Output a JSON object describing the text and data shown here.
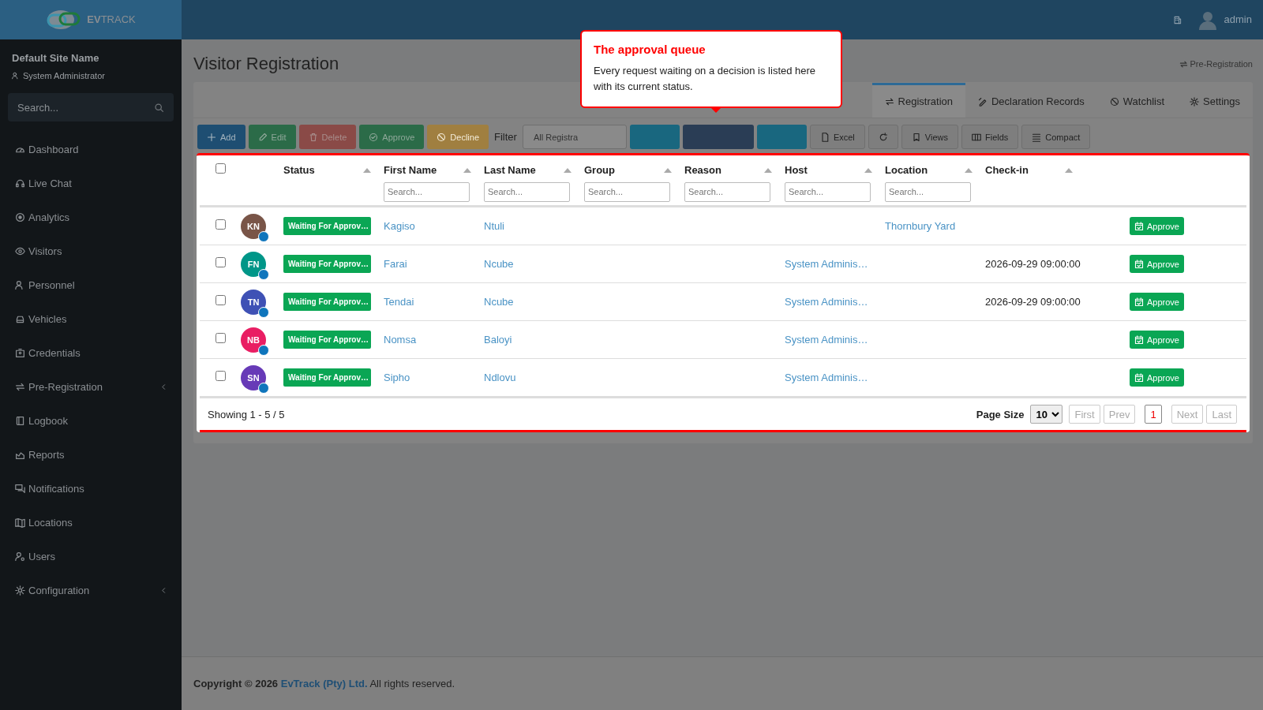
{
  "header": {
    "logo": "**EV**TRACK",
    "user": "admin"
  },
  "sidebar": {
    "site": "Default Site Name",
    "role": "System Administrator",
    "search_placeholder": "Search...",
    "items": [
      {
        "label": "Dashboard",
        "submenu": false
      },
      {
        "label": "Live Chat",
        "submenu": false
      },
      {
        "label": "Analytics",
        "submenu": false
      },
      {
        "label": "Visitors",
        "submenu": false
      },
      {
        "label": "Personnel",
        "submenu": false
      },
      {
        "label": "Vehicles",
        "submenu": false
      },
      {
        "label": "Credentials",
        "submenu": false
      },
      {
        "label": "Pre-Registration",
        "submenu": true
      },
      {
        "label": "Logbook",
        "submenu": false
      },
      {
        "label": "Reports",
        "submenu": false
      },
      {
        "label": "Notifications",
        "submenu": false
      },
      {
        "label": "Locations",
        "submenu": false
      },
      {
        "label": "Users",
        "submenu": false
      },
      {
        "label": "Configuration",
        "submenu": true
      }
    ]
  },
  "page": {
    "title": "Visitor Registration",
    "link": "Pre-Registration"
  },
  "tabs": [
    {
      "label": "Registration",
      "selected": true
    },
    {
      "label": "Declaration Records",
      "selected": false
    },
    {
      "label": "Watchlist",
      "selected": false
    },
    {
      "label": "Settings",
      "selected": false
    }
  ],
  "toolbar": {
    "buttons": [
      {
        "kind": "add",
        "label": "Add"
      },
      {
        "kind": "edit",
        "label": "Edit"
      },
      {
        "kind": "delete",
        "label": "Delete"
      },
      {
        "kind": "approve",
        "label": "Approve"
      },
      {
        "kind": "decline",
        "label": "Decline"
      }
    ],
    "filter_label": "Filter",
    "filter_value": "All Registra",
    "covered": [
      {
        "kind": "info"
      },
      {
        "kind": "dark"
      },
      {
        "kind": "info"
      }
    ],
    "tools": [
      {
        "kind": "excel",
        "label": "Excel"
      },
      {
        "kind": "refresh"
      },
      {
        "kind": "views",
        "label": "Views"
      },
      {
        "kind": "fields",
        "label": "Fields"
      },
      {
        "kind": "compact",
        "label": "Compact"
      }
    ]
  },
  "tour": {
    "title": "The approval queue",
    "text": "Every request waiting on a decision is listed here with its current status."
  },
  "table": {
    "header_checked": false,
    "columns": [
      {
        "label": "Status"
      },
      {
        "label": "First Name",
        "placeholder": "Search..."
      },
      {
        "label": "Last Name",
        "placeholder": "Search..."
      },
      {
        "label": "Group",
        "placeholder": "Search..."
      },
      {
        "label": "Reason",
        "placeholder": "Search..."
      },
      {
        "label": "Host",
        "placeholder": "Search..."
      },
      {
        "label": "Location",
        "placeholder": "Search..."
      },
      {
        "label": "Check-in"
      }
    ],
    "rows": [
      {
        "checked": false,
        "initials": "KN",
        "color": "#795548",
        "status": "Waiting For Approv…",
        "first_name": "Kagiso",
        "last_name": "Ntuli",
        "location": "Thornbury Yard",
        "action": "Approve"
      },
      {
        "checked": false,
        "initials": "FN",
        "color": "#009688",
        "status": "Waiting For Approv…",
        "first_name": "Farai",
        "last_name": "Ncube",
        "host": "System Adminis…",
        "check_in": "2026-09-29 09:00:00",
        "action": "Approve"
      },
      {
        "checked": false,
        "initials": "TN",
        "color": "#3f51b5",
        "status": "Waiting For Approv…",
        "first_name": "Tendai",
        "last_name": "Ncube",
        "host": "System Adminis…",
        "check_in": "2026-09-29 09:00:00",
        "action": "Approve"
      },
      {
        "checked": false,
        "initials": "NB",
        "color": "#e91e63",
        "status": "Waiting For Approv…",
        "first_name": "Nomsa",
        "last_name": "Baloyi",
        "host": "System Adminis…",
        "action": "Approve"
      },
      {
        "checked": false,
        "initials": "SN",
        "color": "#673ab7",
        "status": "Waiting For Approv…",
        "first_name": "Sipho",
        "last_name": "Ndlovu",
        "host": "System Adminis…",
        "action": "Approve"
      }
    ]
  },
  "pagination": {
    "summary": "Showing 1 - 5 / 5",
    "page_size_label": "Page Size",
    "page_size": "10",
    "nav_before": [
      {
        "label": "First",
        "disabled": true
      },
      {
        "label": "Prev",
        "disabled": true
      }
    ],
    "pages": [
      {
        "label": "1",
        "selected": true
      }
    ],
    "nav_after": [
      {
        "label": "Next",
        "disabled": true
      },
      {
        "label": "Last",
        "disabled": true
      }
    ]
  },
  "footer": {
    "copyright": "Copyright © 2026",
    "company": "EvTrack (Pty) Ltd.",
    "rights": "All rights reserved."
  }
}
